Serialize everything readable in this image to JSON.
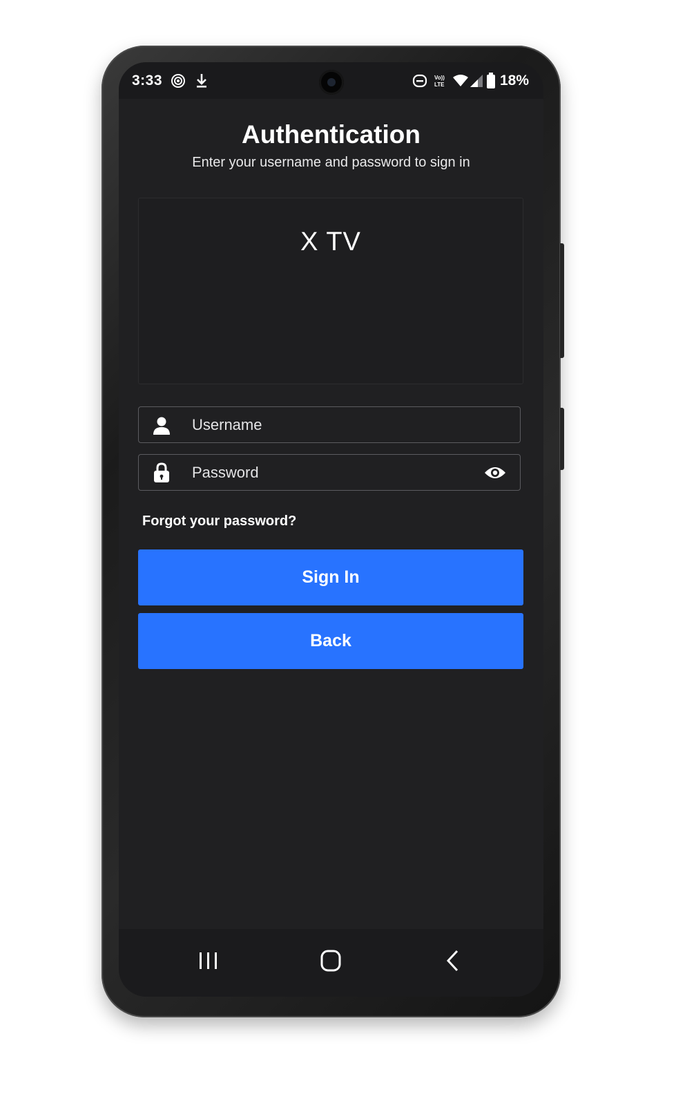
{
  "status_bar": {
    "time": "3:33",
    "battery": "18%",
    "icons": [
      "hotspot-icon",
      "download-icon",
      "sync-icon",
      "volte-icon",
      "wifi-icon",
      "signal-icon",
      "battery-icon"
    ]
  },
  "header": {
    "title": "Authentication",
    "subtitle": "Enter your username and password to sign in"
  },
  "logo": {
    "text": "X TV"
  },
  "form": {
    "username_placeholder": "Username",
    "username_value": "",
    "password_placeholder": "Password",
    "password_value": "",
    "forgot_label": "Forgot your password?"
  },
  "buttons": {
    "sign_in": "Sign In",
    "back": "Back"
  },
  "nav_bar": {
    "icons": [
      "recents-icon",
      "home-icon",
      "back-icon"
    ]
  },
  "colors": {
    "background": "#202022",
    "accent": "#2873ff",
    "text": "#ffffff",
    "field_border": "#5c5c60"
  }
}
